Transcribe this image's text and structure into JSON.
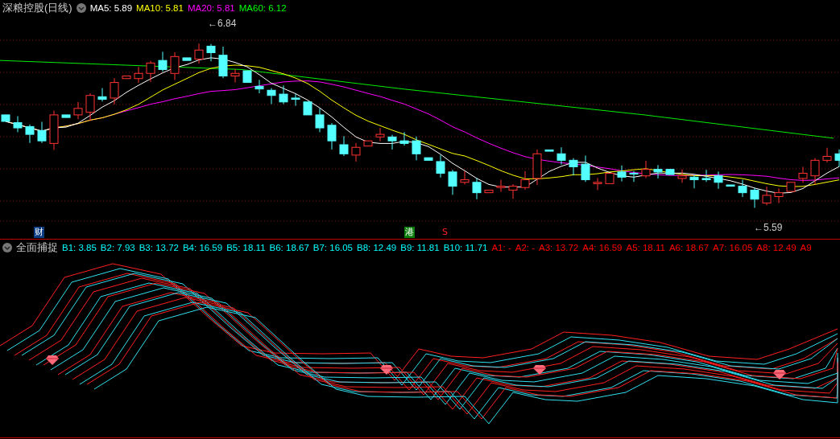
{
  "stock": {
    "name": "深粮控股(日线)"
  },
  "ma_legend": [
    {
      "label": "MA5: 5.89",
      "color": "#ffffff"
    },
    {
      "label": "MA10: 5.81",
      "color": "#ffff00"
    },
    {
      "label": "MA20: 5.81",
      "color": "#ff00ff"
    },
    {
      "label": "MA60: 6.12",
      "color": "#00ff00"
    }
  ],
  "price_chart": {
    "high_label": "←6.84",
    "low_label": "←5.59"
  },
  "event_markers": [
    {
      "text": "财",
      "kind": "finance"
    },
    {
      "text": "港",
      "kind": "hk"
    },
    {
      "text": "S",
      "kind": "signal"
    }
  ],
  "indicator": {
    "name": "全面捕捉",
    "values": [
      {
        "label": "B1: 3.85",
        "color": "#00ffff"
      },
      {
        "label": "B2: 7.93",
        "color": "#00ffff"
      },
      {
        "label": "B3: 13.72",
        "color": "#00ffff"
      },
      {
        "label": "B4: 16.59",
        "color": "#00ffff"
      },
      {
        "label": "B5: 18.11",
        "color": "#00ffff"
      },
      {
        "label": "B6: 18.67",
        "color": "#00ffff"
      },
      {
        "label": "B7: 16.05",
        "color": "#00ffff"
      },
      {
        "label": "B8: 12.49",
        "color": "#00ffff"
      },
      {
        "label": "B9: 11.81",
        "color": "#00ffff"
      },
      {
        "label": "B10: 11.71",
        "color": "#00ffff"
      },
      {
        "label": "A1: -",
        "color": "#ff0000"
      },
      {
        "label": "A2: -",
        "color": "#ff0000"
      },
      {
        "label": "A3: 13.72",
        "color": "#ff0000"
      },
      {
        "label": "A4: 16.59",
        "color": "#ff0000"
      },
      {
        "label": "A5: 18.11",
        "color": "#ff0000"
      },
      {
        "label": "A6: 18.67",
        "color": "#ff0000"
      },
      {
        "label": "A7: 16.05",
        "color": "#ff0000"
      },
      {
        "label": "A8: 12.49",
        "color": "#ff0000"
      },
      {
        "label": "A9",
        "color": "#ff0000"
      }
    ]
  }
}
